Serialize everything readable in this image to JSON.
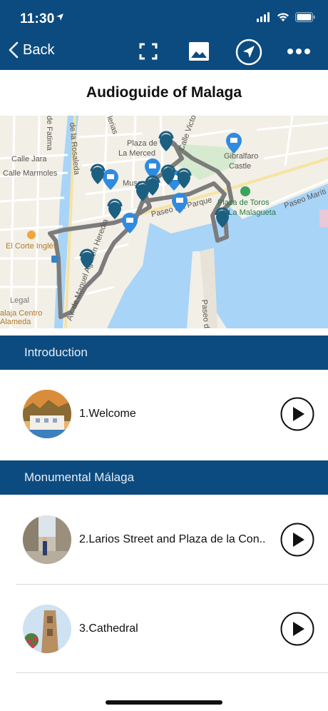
{
  "status_bar": {
    "time": "11:30"
  },
  "nav": {
    "back_label": "Back",
    "icons": [
      "fullscreen-icon",
      "image-icon",
      "navigate-icon",
      "more-icon"
    ]
  },
  "page": {
    "title": "Audioguide of Malaga"
  },
  "map": {
    "labels": {
      "rosaleda": "de la Rosaleda",
      "fatima": "de Fatima",
      "calle_jara": "Calle Jara",
      "calle_marmoles": "Calle Marmoles",
      "plaza_merced": "Plaza de\nLa Merced",
      "calle_victoria": "Calle Victo",
      "gibralfaro": "Gibralfaro\nCastle",
      "museum": "Muse",
      "paseo_parque": "Paseo del Parque",
      "plaza_toros": "Plaza de Toros\nde La Malagueta",
      "paseo_maritimo": "Paseo Maríti",
      "corte_ingles": "El Corte Inglés",
      "av_manuel": "Av. de Manuel Agustín Heredia",
      "malaga_centro": "alaja Centro\nAlameda",
      "legal": "Legal",
      "paseo_de": "Paseo de",
      "lerias": "lerias"
    }
  },
  "sections": [
    {
      "title": "Introduction",
      "items": [
        {
          "label": "1.Welcome",
          "thumb": "welcome-thumbnail"
        }
      ]
    },
    {
      "title": "Monumental Málaga",
      "items": [
        {
          "label": "2.Larios Street and Plaza de la Con...",
          "thumb": "larios-street-thumbnail"
        },
        {
          "label": "3.Cathedral",
          "thumb": "cathedral-thumbnail"
        }
      ]
    }
  ],
  "colors": {
    "brand": "#0c4b7f",
    "pin_dark": "#1d5f80",
    "pin_light": "#2f8be0",
    "route": "#7c7c7c",
    "water": "#a8d4f7"
  }
}
